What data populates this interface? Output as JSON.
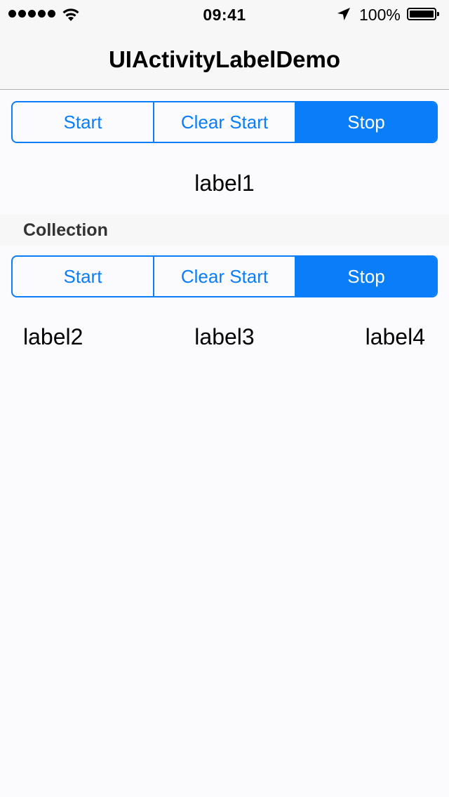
{
  "status_bar": {
    "time": "09:41",
    "battery_percent": "100%",
    "signal_bars": 5,
    "icons": [
      "signal-dots-icon",
      "wifi-icon",
      "location-arrow-icon",
      "battery-icon"
    ]
  },
  "nav": {
    "title": "UIActivityLabelDemo"
  },
  "top_control": {
    "segments": [
      "Start",
      "Clear Start",
      "Stop"
    ],
    "selected_index": 2
  },
  "label1": "label1",
  "collection": {
    "header": "Collection",
    "segments": [
      "Start",
      "Clear Start",
      "Stop"
    ],
    "selected_index": 2,
    "labels": [
      "label2",
      "label3",
      "label4"
    ]
  },
  "colors": {
    "accent": "#0a7df8",
    "background": "#fbfbfe",
    "bar_background": "#f7f7f7"
  }
}
